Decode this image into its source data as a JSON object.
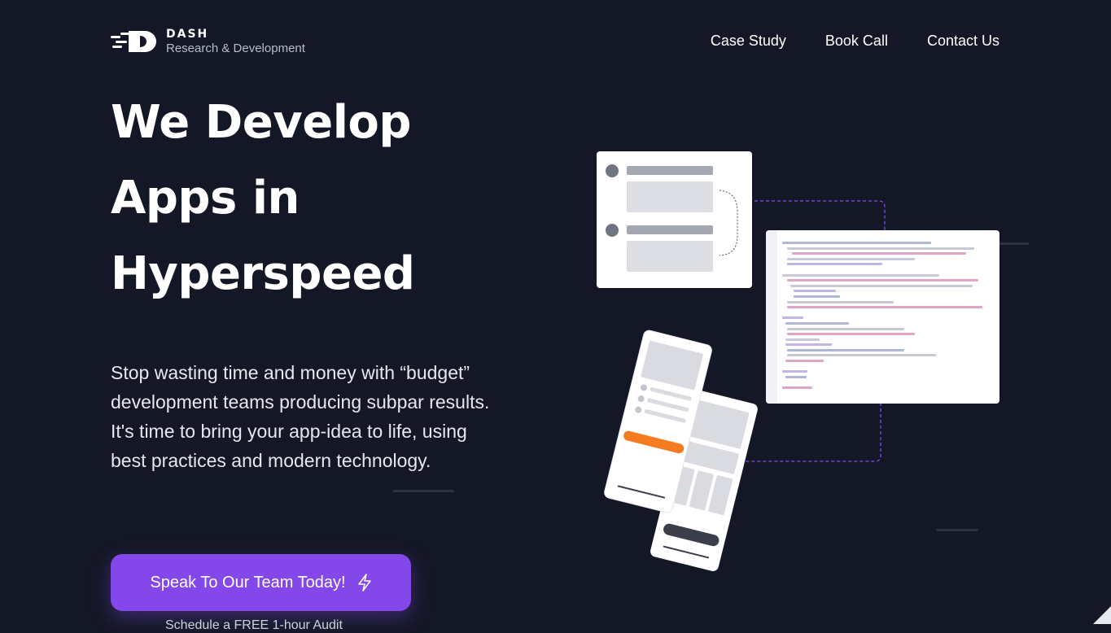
{
  "brand": {
    "name": "DASH",
    "tagline": "Research & Development"
  },
  "nav": {
    "items": [
      {
        "label": "Case Study"
      },
      {
        "label": "Book Call"
      },
      {
        "label": "Contact Us"
      }
    ]
  },
  "hero": {
    "title": "We Develop Apps in Hyperspeed",
    "subtitle": "Stop wasting time and money with “budget” development teams producing subpar results. It's time to bring your app-idea to life, using best practices and modern technology.",
    "cta_label": "Speak To Our Team Today!",
    "below_cta": "Schedule a FREE 1-hour Audit"
  },
  "colors": {
    "background": "#141826",
    "accent": "#8347ea",
    "orange": "#f47b20",
    "card": "#ffffff"
  },
  "icons": [
    "logo-mark-icon",
    "lightning-bolt-icon"
  ]
}
